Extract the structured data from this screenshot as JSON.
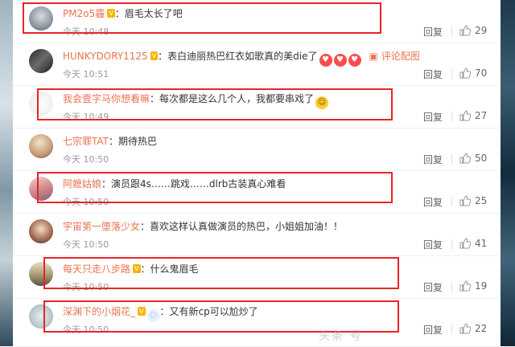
{
  "reply_label": "回复",
  "comments": [
    {
      "user": "PM2o5霾",
      "text": "：眉毛太长了吧",
      "time": "今天 10:48",
      "likes": "29",
      "highlighted": true
    },
    {
      "user": "HUNKYDORY1125",
      "text": "：表白迪丽热巴红衣如歌真的美die了",
      "extra_link": "评论配图",
      "time": "今天 10:51",
      "likes": "70",
      "highlighted": false
    },
    {
      "user": "我会壹字马你想看嘛",
      "text": "：每次都是这么几个人，我都要串戏了",
      "time": "今天 10:49",
      "likes": "27",
      "highlighted": true
    },
    {
      "user": "七宗罪TAT",
      "text": "：期待热巴",
      "time": "今天 10:50",
      "likes": "50",
      "highlighted": false
    },
    {
      "user": "阿嬷姑娘",
      "text": "：演员跟4s……跳戏……dlrb古装真心难看",
      "time": "今天 10:50",
      "likes": "25",
      "highlighted": true
    },
    {
      "user": "宇宙第一堕落少女",
      "text": "：喜欢这样认真做演员的热巴，小姐姐加油！！",
      "time": "今天 10:50",
      "likes": "41",
      "highlighted": false
    },
    {
      "user": "每天只走八步路",
      "text": "：什么鬼眉毛",
      "time": "今天 10:50",
      "likes": "19",
      "highlighted": true
    },
    {
      "user": "深渊下的小烟花_",
      "text": "：又有新cp可以尬炒了",
      "time": "今天 10:50",
      "likes": "22",
      "highlighted": true
    }
  ],
  "watermark": "头条 号"
}
